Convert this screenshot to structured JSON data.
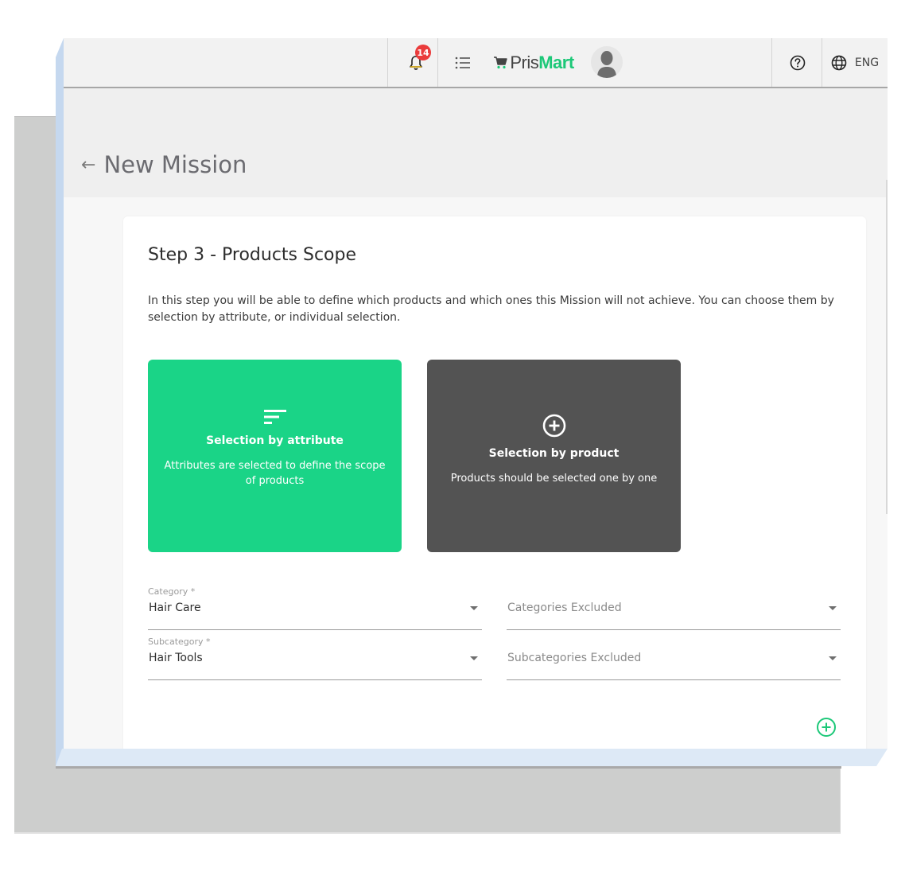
{
  "topbar": {
    "notifications_count": "14",
    "brand_prefix": "Pris",
    "brand_suffix": "Mart",
    "language": "ENG"
  },
  "icons": {
    "bell": "bell-icon",
    "menu": "list-icon",
    "cart": "cart-icon",
    "avatar": "user-avatar-icon",
    "help": "help-circle-icon",
    "globe": "globe-icon",
    "back": "arrow-left-icon",
    "filter": "sort-lines-icon",
    "add": "plus-circle-icon"
  },
  "page": {
    "title": "New Mission",
    "back_glyph": "←"
  },
  "step": {
    "title": "Step 3 - Products Scope",
    "description": "In this step you will be able to define which products and which ones this Mission will not achieve. You can choose them by selection by attribute, or individual selection."
  },
  "options": [
    {
      "title": "Selection by attribute",
      "description": "Attributes are selected to define the scope of products",
      "selected": true
    },
    {
      "title": "Selection by product",
      "description": "Products should be selected one by one",
      "selected": false
    }
  ],
  "form": {
    "category": {
      "label": "Category *",
      "value": "Hair Care"
    },
    "categories_excluded": {
      "placeholder": "Categories Excluded"
    },
    "subcategory": {
      "label": "Subcategory *",
      "value": "Hair Tools"
    },
    "subcategories_excluded": {
      "placeholder": "Subcategories Excluded"
    }
  },
  "colors": {
    "brand_green": "#1cc878",
    "option_selected": "#1ad487",
    "option_unselected": "#535353",
    "badge_red": "#ea3b3b"
  }
}
